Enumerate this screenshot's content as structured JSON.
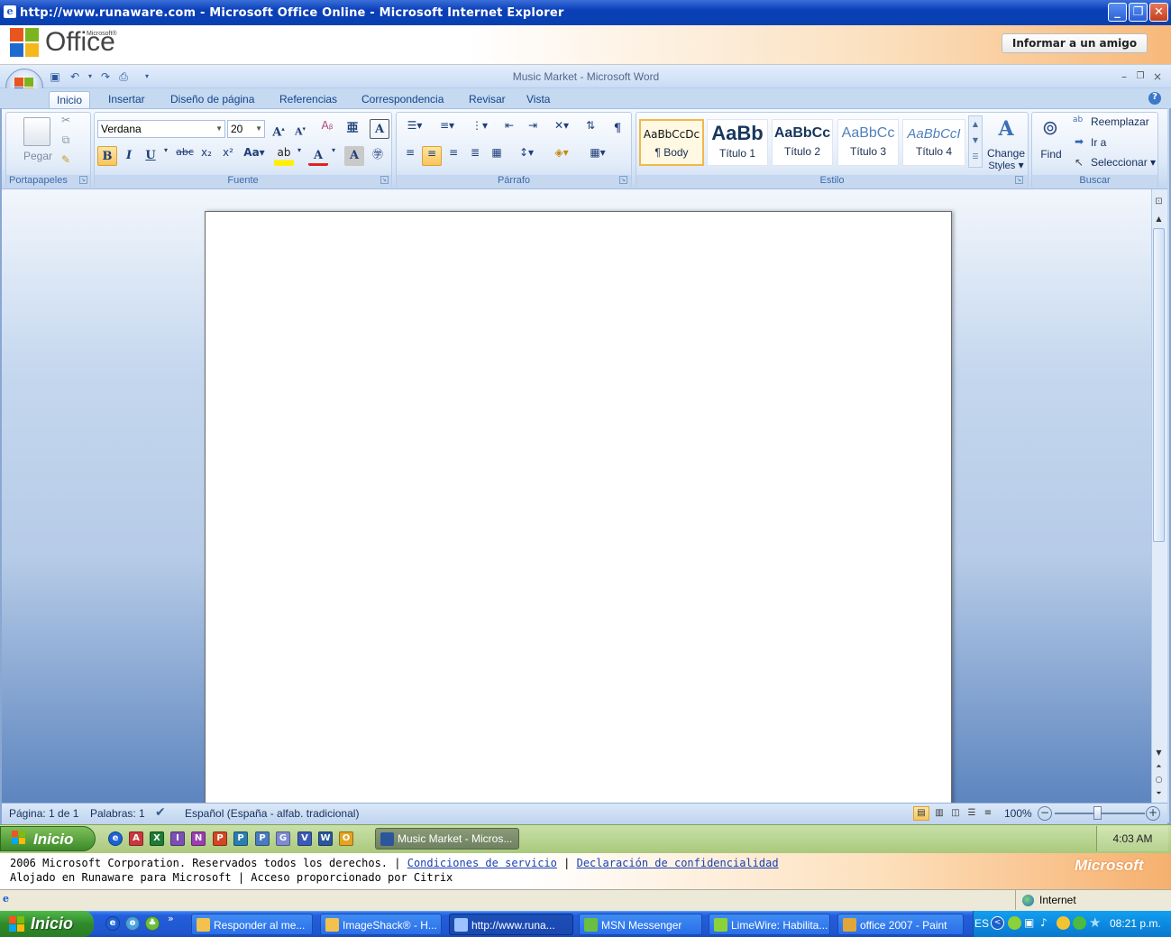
{
  "ie": {
    "title": "http://www.runaware.com - Microsoft Office Online - Microsoft Internet Explorer",
    "status_zone": "Internet"
  },
  "office_banner": {
    "logo_small": "Microsoft®",
    "logo_text": "Office",
    "button": "Informar a un amigo"
  },
  "word": {
    "title": "Music Market - Microsoft Word",
    "tabs": [
      "Inicio",
      "Insertar",
      "Diseño de página",
      "Referencias",
      "Correspondencia",
      "Revisar",
      "Vista"
    ],
    "groups": {
      "portapapeles": "Portapapeles",
      "fuente": "Fuente",
      "parrafo": "Párrafo",
      "estilo": "Estilo",
      "buscar": "Buscar"
    },
    "paste_label": "Pegar",
    "font_name": "Verdana",
    "font_size": "20",
    "styles": [
      {
        "preview": "AaBbCcDc",
        "name": "¶ Body"
      },
      {
        "preview": "AaBb",
        "name": "Título 1"
      },
      {
        "preview": "AaBbCc",
        "name": "Título 2"
      },
      {
        "preview": "AaBbCc",
        "name": "Título 3"
      },
      {
        "preview": "AaBbCcI",
        "name": "Título 4"
      }
    ],
    "change_styles": "Change",
    "change_styles2": "Styles",
    "find_label": "Find",
    "replace_label": "Reemplazar",
    "goto_label": "Ir a",
    "select_label": "Seleccionar",
    "status": {
      "page": "Página: 1 de 1",
      "words": "Palabras: 1",
      "language": "Español (España - alfab. tradicional)",
      "zoom": "100%"
    }
  },
  "citrix_taskbar": {
    "start": "Inicio",
    "task": "Music Market - Micros...",
    "clock": "4:03 AM"
  },
  "footer": {
    "line1": "2006 Microsoft Corporation. Reservados todos los derechos. |",
    "link1": "Condiciones de servicio",
    "sep": "|",
    "link2": "Declaración de confidencialidad",
    "line2": "Alojado en Runaware para Microsoft | Acceso proporcionado por Citrix",
    "brand": "Microsoft"
  },
  "xp_taskbar": {
    "start": "Inicio",
    "tasks": [
      "Responder al me...",
      "ImageShack® - H...",
      "http://www.runa...",
      "MSN Messenger",
      "LimeWire: Habilita...",
      "office 2007 - Paint"
    ],
    "lang": "ES",
    "clock": "08:21 p.m."
  }
}
